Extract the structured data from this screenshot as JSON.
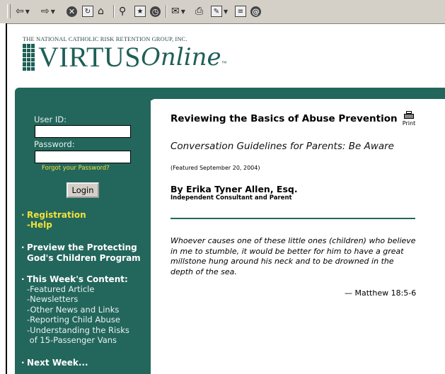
{
  "toolbar": {
    "buttons": [
      "back-icon",
      "forward-icon",
      "stop-icon",
      "refresh-icon",
      "home-icon",
      "search-icon",
      "favorites-icon",
      "history-icon",
      "mail-icon",
      "print-icon",
      "edit-icon",
      "discuss-icon",
      "messenger-icon"
    ]
  },
  "header": {
    "org_line": "THE NATIONAL CATHOLIC RISK RETENTION GROUP, INC.",
    "logo_main": "VIRTUS",
    "logo_script": "Online",
    "logo_tm": "™"
  },
  "sidebar": {
    "user_id_label": "User ID:",
    "password_label": "Password:",
    "user_id_value": "",
    "password_value": "",
    "forgot_password": "Forgot your Password?",
    "login_label": "Login",
    "registration": "Registration",
    "help": "-Help",
    "preview_line1": "Preview the Protecting",
    "preview_line2": "God's Children Program",
    "this_week": "This Week's Content:",
    "content_links": [
      "-Featured Article",
      "-Newsletters",
      "-Other News and Links",
      "-Reporting Child Abuse",
      "-Understanding the Risks",
      " of 15-Passenger Vans"
    ],
    "next_week": "Next Week..."
  },
  "article": {
    "title": "Reviewing the Basics of Abuse Prevention",
    "print_label": "Print",
    "subtitle": "Conversation Guidelines for Parents: Be Aware",
    "featured": "(Featured September 20, 2004)",
    "author": "By Erika Tyner Allen, Esq.",
    "author_role": "Independent Consultant and Parent",
    "quote": "Whoever causes one of these little ones (children) who believe in me to stumble, it would be better for him to have a great millstone hung around his neck and to be drowned in the depth of the sea.",
    "citation": "— Matthew 18:5-6"
  },
  "colors": {
    "teal": "#23665c",
    "link_yellow": "#f2e23a",
    "toolbar_gray": "#d4d0c8"
  }
}
